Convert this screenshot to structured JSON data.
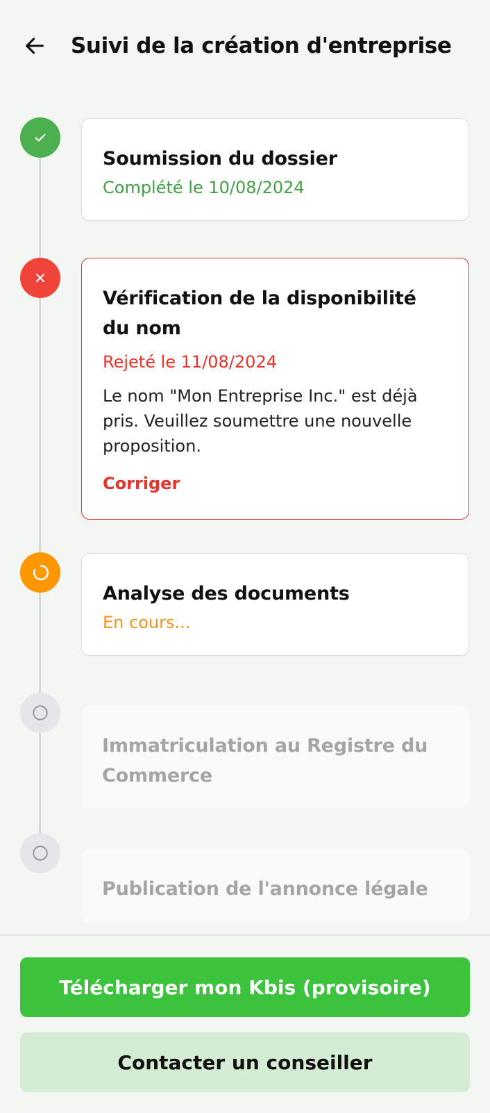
{
  "header": {
    "title": "Suivi de la création d'entreprise",
    "back_icon": "arrow-left-icon"
  },
  "steps": [
    {
      "state": "completed",
      "icon": "check-icon",
      "title": "Soumission du dossier",
      "status": "Complété le 10/08/2024"
    },
    {
      "state": "rejected",
      "icon": "close-icon",
      "title": "Vérification de la disponibilité du nom",
      "status": "Rejeté le 11/08/2024",
      "description": "Le nom \"Mon Entreprise Inc.\" est déjà pris. Veuillez soumettre une nouvelle proposition.",
      "action": "Corriger"
    },
    {
      "state": "in-progress",
      "icon": "spinner-icon",
      "title": "Analyse des documents",
      "status": "En cours..."
    },
    {
      "state": "pending",
      "icon": "circle-icon",
      "title": "Immatriculation au Registre du Commerce"
    },
    {
      "state": "pending",
      "icon": "circle-icon",
      "title": "Publication de l'annonce légale"
    }
  ],
  "footer": {
    "primary_label": "Télécharger mon Kbis (provisoire)",
    "secondary_label": "Contacter un conseiller"
  },
  "colors": {
    "completed": "#4caf50",
    "rejected": "#f0433a",
    "in_progress": "#ff9800",
    "pending": "#e4e6ea",
    "primary_button": "#3cc23d",
    "secondary_button": "#d4ebd4"
  }
}
